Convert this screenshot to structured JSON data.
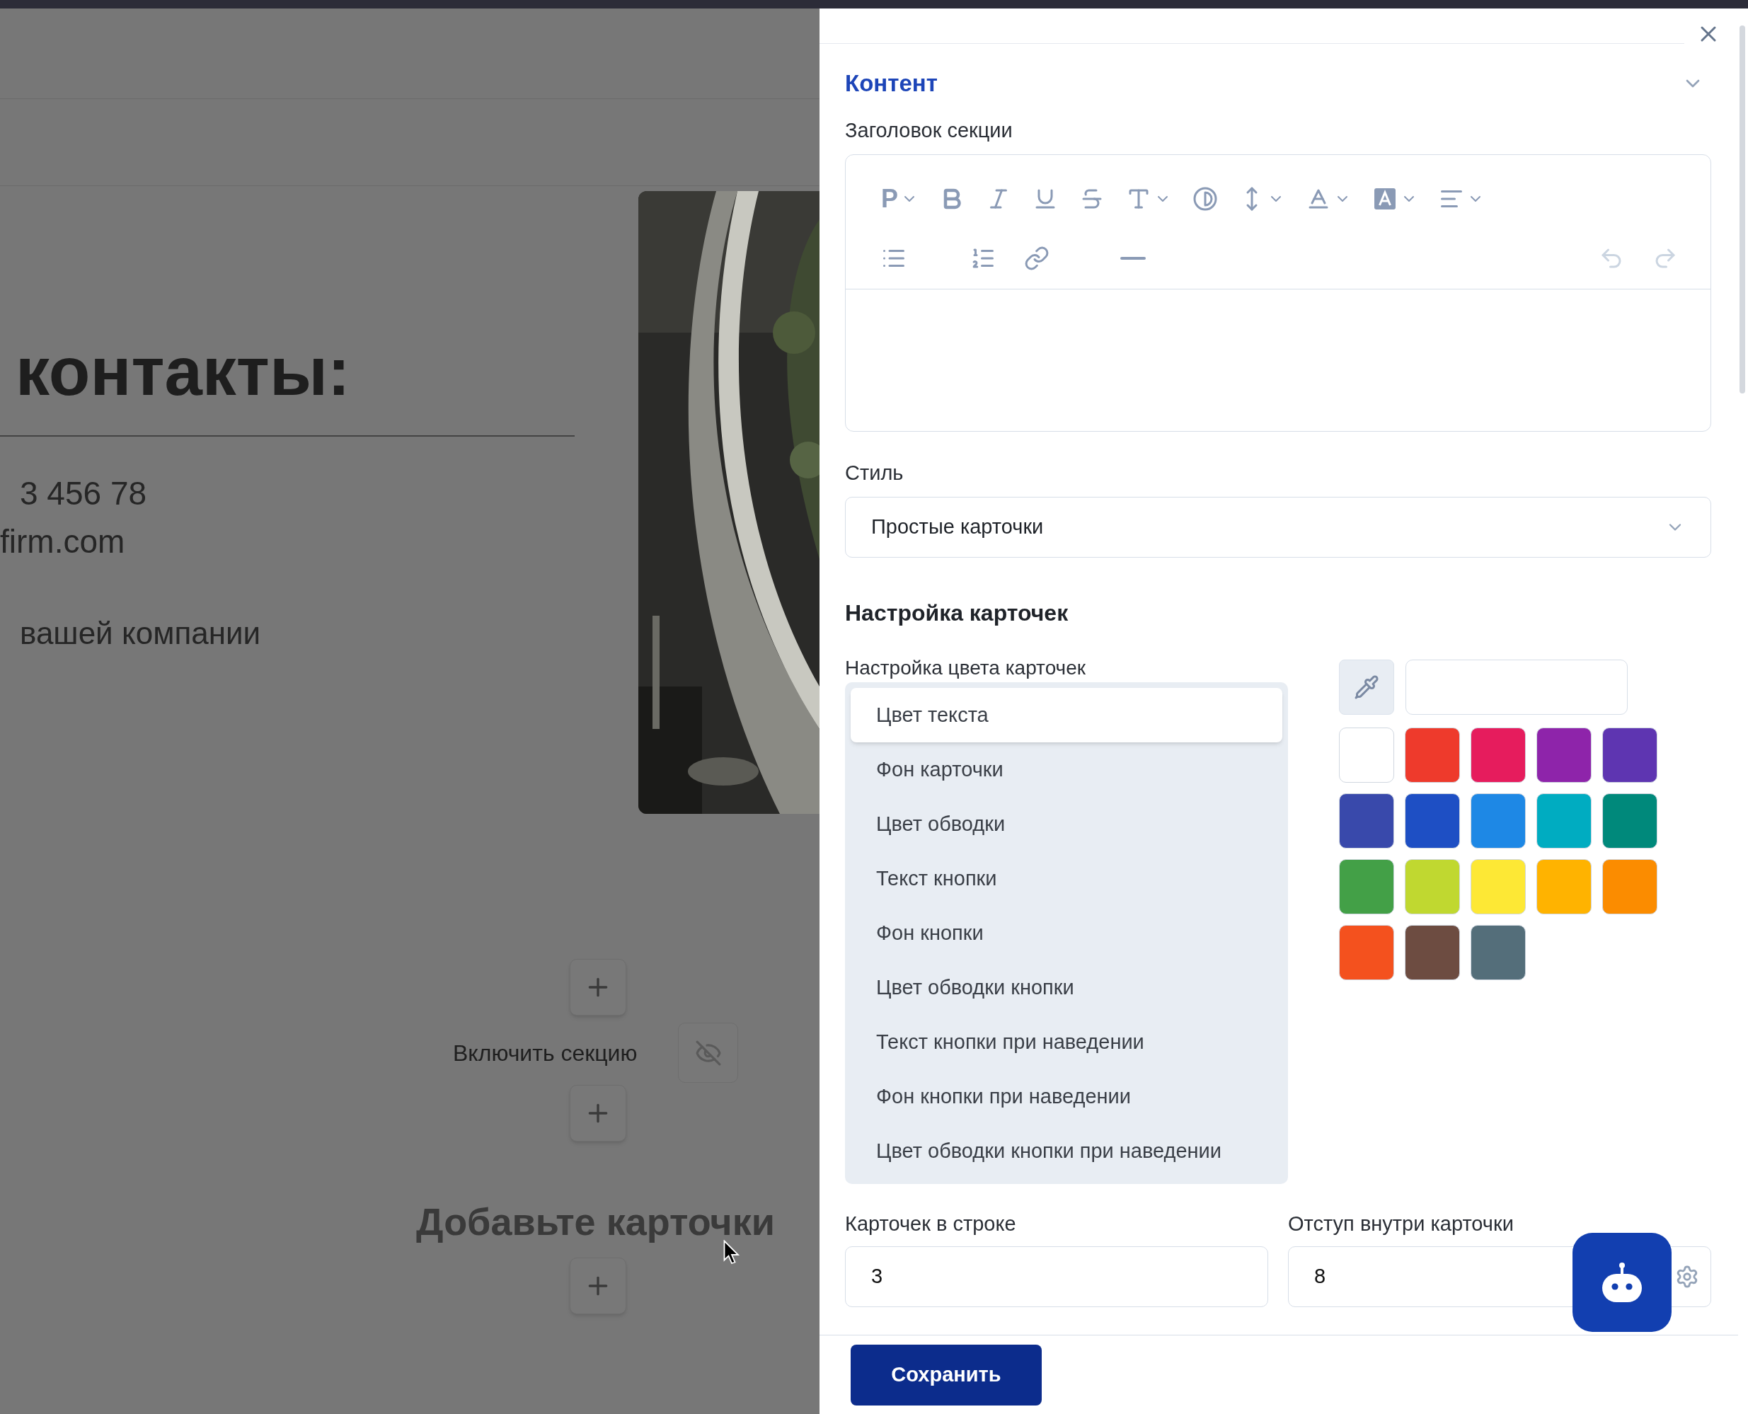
{
  "page": {
    "heading": "контакты:",
    "phone": "3 456 78",
    "email": "firm.com",
    "description": "вашей компании",
    "enable_label": "Включить секцию",
    "section_visible": false,
    "add_cards": "Добавьте карточки"
  },
  "panel": {
    "section_title": "Контент",
    "expanded": true,
    "heading_label": "Заголовок секции",
    "toolbar": [
      {
        "kind": "paragraph",
        "text": "P",
        "dropdown": true,
        "disabled": false
      },
      {
        "kind": "bold",
        "dropdown": false,
        "disabled": false
      },
      {
        "kind": "italic",
        "dropdown": false,
        "disabled": false
      },
      {
        "kind": "underline",
        "dropdown": false,
        "disabled": false
      },
      {
        "kind": "strike",
        "dropdown": false,
        "disabled": false
      },
      {
        "kind": "font",
        "dropdown": true,
        "disabled": false
      },
      {
        "kind": "contrast",
        "dropdown": false,
        "disabled": false
      },
      {
        "kind": "size",
        "dropdown": true,
        "disabled": false
      },
      {
        "kind": "textcolor",
        "dropdown": true,
        "disabled": false
      },
      {
        "kind": "highlight",
        "dropdown": true,
        "disabled": false
      },
      {
        "kind": "align",
        "dropdown": true,
        "disabled": false
      }
    ],
    "toolbar2": [
      {
        "kind": "bullets",
        "disabled": false
      },
      {
        "kind": "numbers",
        "disabled": false
      },
      {
        "kind": "link",
        "disabled": false
      },
      {
        "kind": "rule",
        "disabled": false
      }
    ],
    "history": [
      {
        "kind": "undo",
        "disabled": true
      },
      {
        "kind": "redo",
        "disabled": true
      }
    ],
    "style_label": "Стиль",
    "style_value": "Простые карточки",
    "cards_title": "Настройка карточек",
    "color_label": "Настройка цвета карточек",
    "color_targets": [
      {
        "label": "Цвет текста",
        "selected": true
      },
      {
        "label": "Фон карточки",
        "selected": false
      },
      {
        "label": "Цвет обводки",
        "selected": false
      },
      {
        "label": "Текст кнопки",
        "selected": false
      },
      {
        "label": "Фон кнопки",
        "selected": false
      },
      {
        "label": "Цвет обводки кнопки",
        "selected": false
      },
      {
        "label": "Текст кнопки при наведении",
        "selected": false
      },
      {
        "label": "Фон кнопки при наведении",
        "selected": false
      },
      {
        "label": "Цвет обводки кнопки при наведении",
        "selected": false
      }
    ],
    "swatches": [
      {
        "color": "#ffffff"
      },
      {
        "color": "#ee3a2c"
      },
      {
        "color": "#e61c5d"
      },
      {
        "color": "#8e24aa"
      },
      {
        "color": "#5e35b1"
      },
      {
        "color": "#3949ab"
      },
      {
        "color": "#1e4fc4"
      },
      {
        "color": "#1e88e5"
      },
      {
        "color": "#00acc1"
      },
      {
        "color": "#00897b"
      },
      {
        "color": "#43a047"
      },
      {
        "color": "#c0d830"
      },
      {
        "color": "#fde835"
      },
      {
        "color": "#ffb300"
      },
      {
        "color": "#fb8c00"
      },
      {
        "color": "#f4511e"
      },
      {
        "color": "#6d4c41"
      },
      {
        "color": "#546e7a"
      }
    ],
    "fields": [
      {
        "label": "Карточек в строке",
        "value": "3",
        "settings": false
      },
      {
        "label": "Отступ внутри карточки",
        "value": "8",
        "settings": true
      }
    ],
    "save": "Сохранить"
  }
}
